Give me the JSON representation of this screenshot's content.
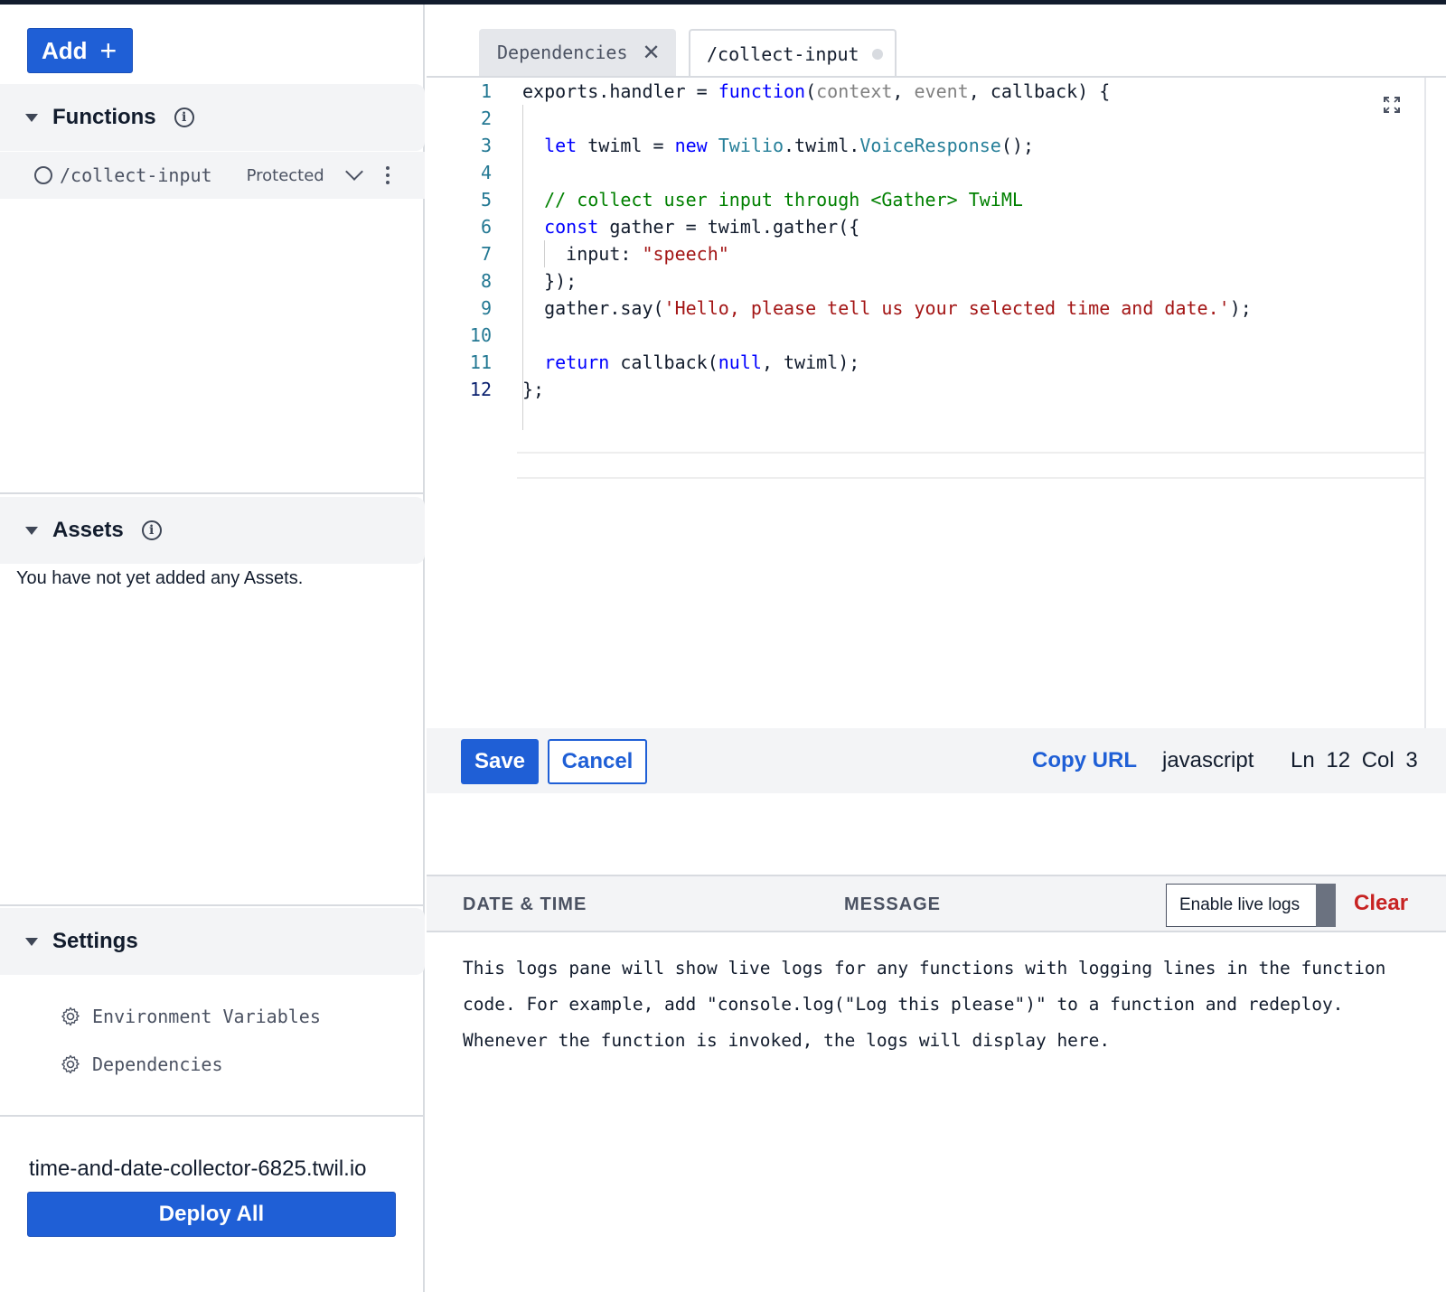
{
  "sidebar": {
    "add_label": "Add",
    "add_icon": "+",
    "functions": {
      "title": "Functions",
      "items": [
        {
          "path": "/collect-input",
          "visibility": "Protected"
        }
      ]
    },
    "assets": {
      "title": "Assets",
      "empty_text": "You have not yet added any Assets."
    },
    "settings": {
      "title": "Settings",
      "items": [
        {
          "label": "Environment Variables",
          "icon": "gear-icon"
        },
        {
          "label": "Dependencies",
          "icon": "gear-icon"
        }
      ]
    },
    "domain": "time-and-date-collector-6825.twil.io",
    "deploy_label": "Deploy All"
  },
  "tabs": [
    {
      "label": "Dependencies",
      "icon": "close-icon"
    },
    {
      "label": "/collect-input",
      "icon": "unsaved-dot-icon"
    }
  ],
  "editor": {
    "line_numbers": [
      "1",
      "2",
      "3",
      "4",
      "5",
      "6",
      "7",
      "8",
      "9",
      "10",
      "11",
      "12"
    ],
    "lines": [
      "exports.handler = function(context, event, callback) {",
      "",
      "  let twiml = new Twilio.twiml.VoiceResponse();",
      "",
      "  // collect user input through <Gather> TwiML",
      "  const gather = twiml.gather({",
      "    input: \"speech\"",
      "  });",
      "  gather.say('Hello, please tell us your selected time and date.');",
      "",
      "  return callback(null, twiml);",
      "};"
    ]
  },
  "toolbar": {
    "save_label": "Save",
    "cancel_label": "Cancel",
    "copy_url_label": "Copy URL",
    "language": "javascript",
    "position": "Ln 12  Col 3"
  },
  "logs": {
    "col_date": "DATE & TIME",
    "col_message": "MESSAGE",
    "live_logs_label": "Enable live logs",
    "clear_label": "Clear",
    "message": "This logs pane will show live logs for any functions with logging lines in the function code. For example, add \"console.log(\"Log this please\")\" to a function and redeploy. Whenever the function is invoked, the logs will display here."
  },
  "colors": {
    "primary": "#1f5fd6",
    "danger": "#c72323",
    "panel": "#f3f4f6"
  }
}
